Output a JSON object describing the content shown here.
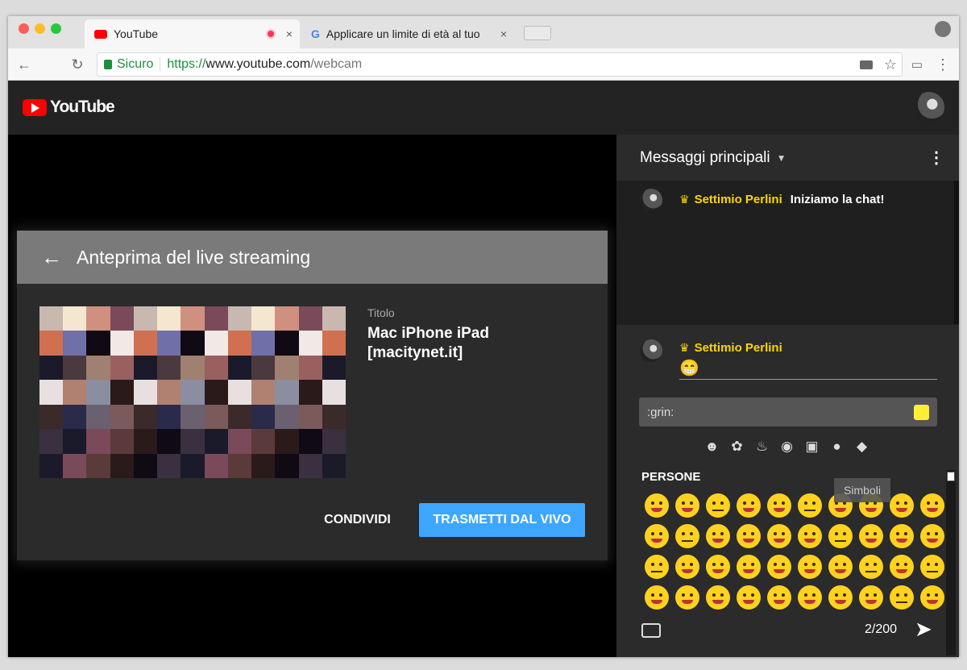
{
  "browser": {
    "tabs": [
      {
        "title": "YouTube",
        "close": "×"
      },
      {
        "title": "Applicare un limite di età al tuo",
        "close": "×"
      }
    ],
    "url": {
      "secure_label": "Sicuro",
      "protocol": "https://",
      "host": "www.youtube.com",
      "path": "/webcam"
    }
  },
  "youtube": {
    "logo_text": "YouTube"
  },
  "dialog": {
    "title": "Anteprima del live streaming",
    "meta_label": "Titolo",
    "stream_title": "Mac iPhone iPad [macitynet.it]",
    "share_button": "CONDIVIDI",
    "live_button": "TRASMETTI DAL VIVO"
  },
  "chat": {
    "mode": "Messaggi principali",
    "messages": [
      {
        "author": "Settimio Perlini",
        "text": "Iniziamo la chat!"
      }
    ],
    "composer": {
      "author": "Settimio Perlini",
      "input_value": "😁",
      "search_value": ":grin:",
      "section": "PERSONE",
      "tooltip": "Simboli",
      "counter": "2/200"
    }
  },
  "colors": {
    "accent": "#3ea6ff",
    "author": "#ffd600",
    "youtube_red": "#ff0000"
  }
}
